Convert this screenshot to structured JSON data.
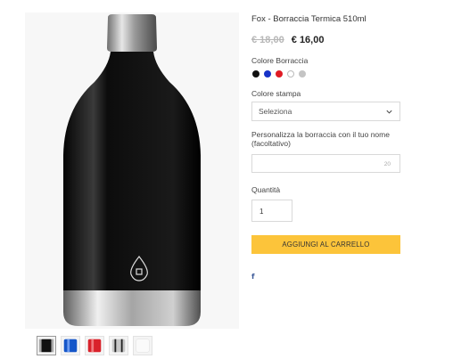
{
  "product": {
    "title": "Fox - Borraccia Termica 510ml",
    "old_price": "€ 18,00",
    "new_price": "€ 16,00"
  },
  "gallery": {
    "main_image_icon": "black-thermal-bottle-image",
    "thumbnails": [
      {
        "color": "#111111",
        "name": "black-bottle-thumbnail"
      },
      {
        "color": "#1556c9",
        "name": "blue-bottle-thumbnail"
      },
      {
        "color": "#d9222b",
        "name": "red-bottle-thumbnail"
      },
      {
        "color": "#c8c8c8",
        "name": "silver-bottle-thumbnail"
      },
      {
        "color": "#f2f2f2",
        "name": "white-bottle-thumbnail"
      }
    ]
  },
  "color_option": {
    "label": "Colore Borraccia",
    "swatches": [
      "#111111",
      "#1733c8",
      "#e01b24",
      "#ffffff",
      "#c4c4c4"
    ]
  },
  "print_option": {
    "label": "Colore stampa",
    "selected": "Seleziona"
  },
  "name_option": {
    "label": "Personalizza la borraccia con il tuo nome (facoltativo)",
    "value": "",
    "char_limit": "20"
  },
  "quantity": {
    "label": "Quantità",
    "value": "1"
  },
  "cart": {
    "button_label": "AGGIUNGI AL CARRELLO"
  },
  "share": {
    "facebook_glyph": "f"
  },
  "colors": {
    "accent": "#fcc43a",
    "facebook": "#3b5998"
  }
}
